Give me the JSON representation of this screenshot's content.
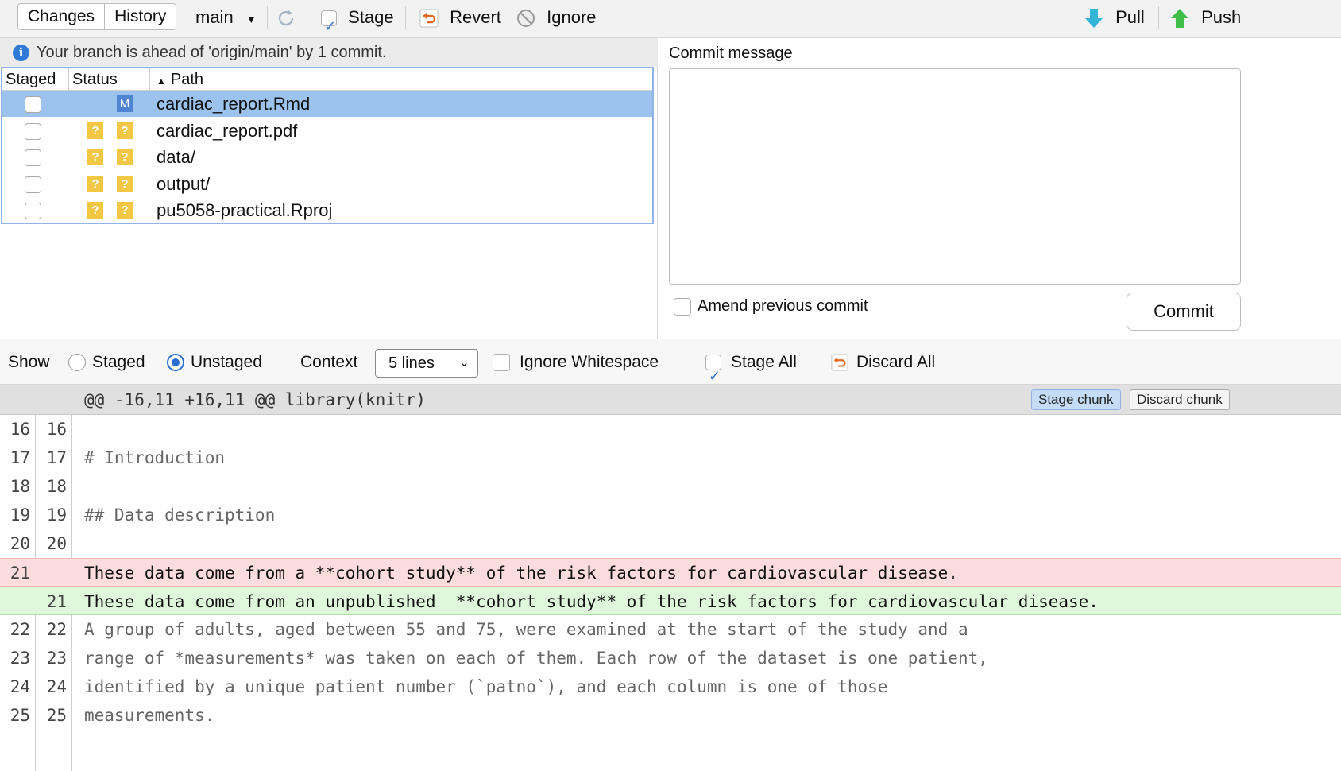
{
  "toolbar": {
    "tabs": [
      "Changes",
      "History"
    ],
    "branch": "main",
    "stage_label": "Stage",
    "revert_label": "Revert",
    "ignore_label": "Ignore",
    "pull_label": "Pull",
    "push_label": "Push"
  },
  "info_message": "Your branch is ahead of 'origin/main' by 1 commit.",
  "files": {
    "headers": [
      "Staged",
      "Status",
      "Path"
    ],
    "rows": [
      {
        "staged": false,
        "status": [
          "",
          "M"
        ],
        "path": "cardiac_report.Rmd",
        "selected": true
      },
      {
        "staged": false,
        "status": [
          "?",
          "?"
        ],
        "path": "cardiac_report.pdf",
        "selected": false
      },
      {
        "staged": false,
        "status": [
          "?",
          "?"
        ],
        "path": "data/",
        "selected": false
      },
      {
        "staged": false,
        "status": [
          "?",
          "?"
        ],
        "path": "output/",
        "selected": false
      },
      {
        "staged": false,
        "status": [
          "?",
          "?"
        ],
        "path": "pu5058-practical.Rproj",
        "selected": false
      }
    ]
  },
  "commit": {
    "label": "Commit message",
    "message": "",
    "amend_label": "Amend previous commit",
    "button": "Commit"
  },
  "diff_toolbar": {
    "show_label": "Show",
    "staged_label": "Staged",
    "unstaged_label": "Unstaged",
    "context_label": "Context",
    "context_value": "5 lines",
    "ignore_ws_label": "Ignore Whitespace",
    "stage_all_label": "Stage All",
    "discard_all_label": "Discard All"
  },
  "diff": {
    "hunk_header": "@@ -16,11 +16,11 @@ library(knitr)",
    "stage_chunk": "Stage chunk",
    "discard_chunk": "Discard chunk",
    "lines": [
      {
        "a": "16",
        "b": "16",
        "type": "ctx",
        "text": ""
      },
      {
        "a": "17",
        "b": "17",
        "type": "ctx",
        "text": "# Introduction"
      },
      {
        "a": "18",
        "b": "18",
        "type": "ctx",
        "text": ""
      },
      {
        "a": "19",
        "b": "19",
        "type": "ctx",
        "text": "## Data description"
      },
      {
        "a": "20",
        "b": "20",
        "type": "ctx",
        "text": ""
      },
      {
        "a": "21",
        "b": "",
        "type": "del",
        "text": "These data come from a **cohort study** of the risk factors for cardiovascular disease."
      },
      {
        "a": "",
        "b": "21",
        "type": "add",
        "text": "These data come from an unpublished  **cohort study** of the risk factors for cardiovascular disease."
      },
      {
        "a": "22",
        "b": "22",
        "type": "ctx",
        "text": "A group of adults, aged between 55 and 75, were examined at the start of the study and a"
      },
      {
        "a": "23",
        "b": "23",
        "type": "ctx",
        "text": "range of *measurements* was taken on each of them. Each row of the dataset is one patient,"
      },
      {
        "a": "24",
        "b": "24",
        "type": "ctx",
        "text": "identified by a unique patient number (`patno`), and each column is one of those"
      },
      {
        "a": "25",
        "b": "25",
        "type": "ctx",
        "text": "measurements."
      }
    ]
  }
}
